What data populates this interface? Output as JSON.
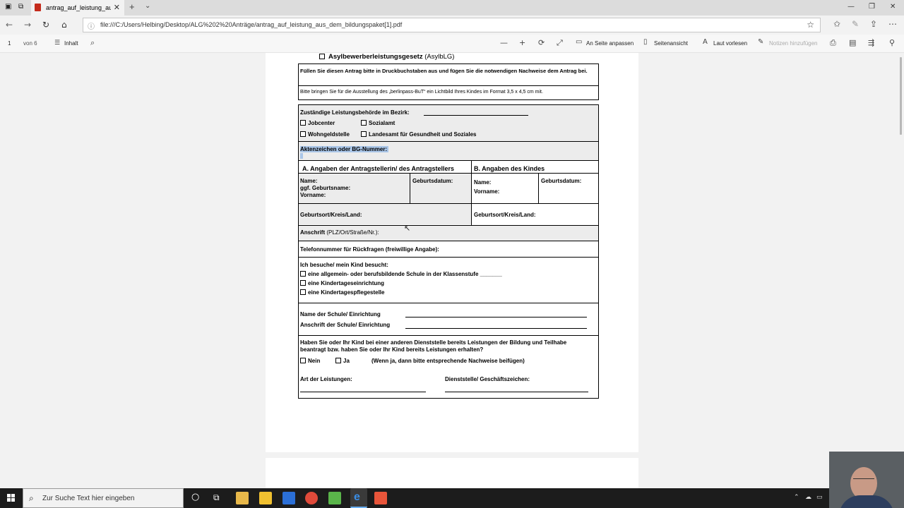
{
  "browser": {
    "tab_title": "antrag_auf_leistung_aus",
    "url": "file:///C:/Users/Helbing/Desktop/ALG%202%20Anträge/antrag_auf_leistung_aus_dem_bildungspaket[1].pdf"
  },
  "pdf_toolbar": {
    "page_number": "1",
    "page_of": "von 6",
    "contents_label": "Inhalt",
    "fit_page_label": "An Seite anpassen",
    "page_view_label": "Seitenansicht",
    "read_aloud_label": "Laut vorlesen",
    "add_notes_label": "Notizen hinzufügen"
  },
  "form": {
    "asyl_label": "Asylbewerberleistungsgesetz",
    "asyl_abbr": "(AsylbLG)",
    "instruction1": "Füllen Sie diesen Antrag bitte in Druckbuchstaben aus und fügen Sie die notwendigen Nachweise dem Antrag bei.",
    "instruction2": "Bitte bringen Sie für die Ausstellung des „berlinpass-BuT“ ein Lichtbild Ihres Kindes im Format 3,5 x 4,5 cm mit.",
    "authority_label": "Zuständige Leistungsbehörde im Bezirk:",
    "jobcenter": "Jobcenter",
    "sozialamt": "Sozialamt",
    "wohngeldstelle": "Wohngeldstelle",
    "landesamt": "Landesamt für Gesundheit und Soziales",
    "aktenzeichen": "Aktenzeichen oder BG-Nummer:",
    "header_a": "A. Angaben der Antragstellerin/ des Antragstellers",
    "header_b": "B. Angaben des Kindes",
    "name_a_1": "Name:",
    "name_a_2": "ggf. Geburtsname:",
    "name_a_3": "Vorname:",
    "geburtsdatum_a": "Geburtsdatum:",
    "name_b_1": "Name:",
    "name_b_2": "Vorname:",
    "geburtsdatum_b": "Geburtsdatum:",
    "geburtsort_a": "Geburtsort/Kreis/Land:",
    "geburtsort_b": "Geburtsort/Kreis/Land:",
    "anschrift": "Anschrift",
    "anschrift_hint": "(PLZ/Ort/Straße/Nr.):",
    "telefon": "Telefonnummer für Rückfragen (freiwillige Angabe):",
    "besuch": "Ich besuche/ mein Kind besucht:",
    "opt_schule": "eine allgemein- oder berufsbildende Schule in der Klassenstufe _______",
    "opt_kita": "eine Kindertageseinrichtung",
    "opt_pflege": "eine Kindertagespflegestelle",
    "schule_name": "Name der Schule/ Einrichtung",
    "schule_anschrift": "Anschrift der Schule/ Einrichtung",
    "frage": "Haben Sie oder Ihr Kind bei einer anderen Dienststelle bereits Leistungen der Bildung und Teilhabe beantragt bzw. haben Sie oder Ihr Kind bereits Leistungen erhalten?",
    "nein": "Nein",
    "ja": "Ja",
    "ja_hint": "(Wenn ja, dann bitte entsprechende Nachweise beifügen)",
    "art": "Art der Leistungen:",
    "dienststelle": "Dienststelle/ Geschäftszeichen:"
  },
  "taskbar": {
    "search_placeholder": "Zur Suche Text hier eingeben"
  },
  "colors": {
    "highlight": "#aac6e8",
    "gray_fill": "#ececec",
    "taskbar": "#1c1c1c"
  }
}
